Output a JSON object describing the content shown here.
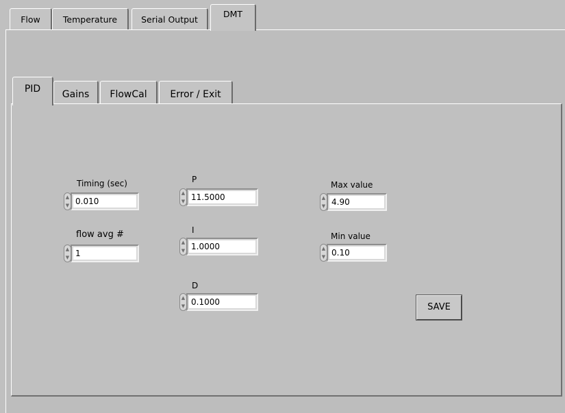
{
  "outer_tabs": {
    "flow": "Flow",
    "temperature": "Temperature",
    "serial_output": "Serial Output",
    "dmt": "DMT"
  },
  "inner_tabs": {
    "pid": "PID",
    "gains": "Gains",
    "flowcal": "FlowCal",
    "error_exit": "Error / Exit"
  },
  "controls": {
    "timing": {
      "label": "Timing (sec)",
      "value": "0.010"
    },
    "flow_avg": {
      "label": "flow avg #",
      "value": "1"
    },
    "p": {
      "label": "P",
      "value": "11.5000"
    },
    "i": {
      "label": "I",
      "value": "1.0000"
    },
    "d": {
      "label": "D",
      "value": "0.1000"
    },
    "max_value": {
      "label": "Max value",
      "value": "4.90"
    },
    "min_value": {
      "label": "Min value",
      "value": "0.10"
    }
  },
  "save_label": "SAVE",
  "spinner_glyphs": {
    "up": "▲",
    "down": "▼"
  }
}
